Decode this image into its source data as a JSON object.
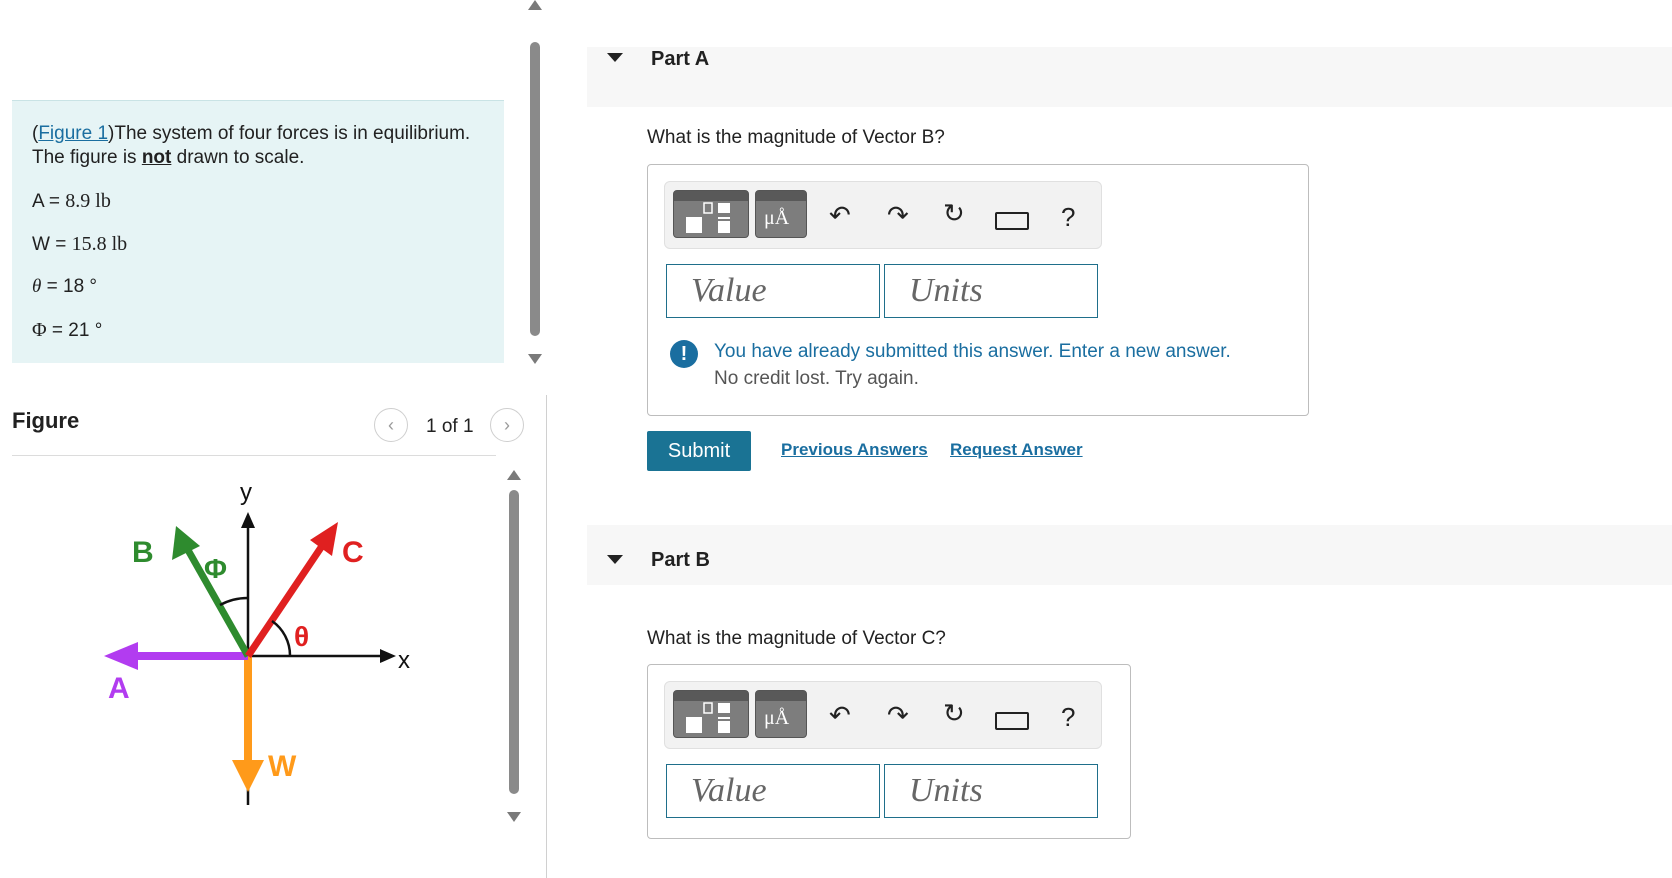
{
  "problem": {
    "figure_link": "Figure 1",
    "text_before_not": ")The system of four forces is in equilibrium. The figure is ",
    "emphasis": "not",
    "text_after_not": " drawn to scale.",
    "open_paren": "(",
    "vars": {
      "A_label": "A = ",
      "A_value": "8.9 lb",
      "W_label": "W = ",
      "W_value": "15.8 lb",
      "theta_sym": "θ",
      "theta_value": " = 18 °",
      "phi_sym": "Φ",
      "phi_value": " = 21 °"
    }
  },
  "figure": {
    "title": "Figure",
    "pager": "1 of 1",
    "prev_icon": "‹",
    "next_icon": "›",
    "labels": {
      "y": "y",
      "x": "x",
      "A": "A",
      "B": "B",
      "C": "C",
      "W": "W",
      "phi": "Φ",
      "theta": "θ"
    },
    "colors": {
      "A": "#b23cf0",
      "B": "#2e8b2e",
      "C": "#e02020",
      "W": "#ff9a1a",
      "axis": "#111111"
    }
  },
  "partA": {
    "title": "Part A",
    "question": "What is the magnitude of Vector B?",
    "value_placeholder": "Value",
    "units_placeholder": "Units",
    "notice_line1": "You have already submitted this answer. Enter a new answer.",
    "notice_line2": "No credit lost. Try again.",
    "notice_icon": "!",
    "submit": "Submit",
    "previous_answers": "Previous Answers",
    "request_answer": "Request Answer"
  },
  "partB": {
    "title": "Part B",
    "question": "What is the magnitude of Vector C?",
    "value_placeholder": "Value",
    "units_placeholder": "Units"
  },
  "toolbar": {
    "units_btn_label": "μÅ",
    "help": "?"
  }
}
